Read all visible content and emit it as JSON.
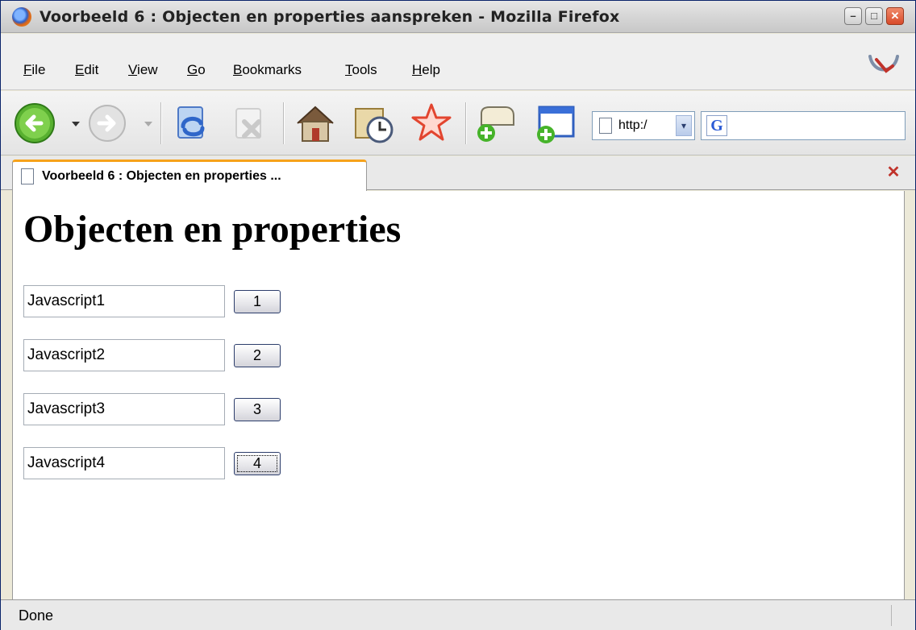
{
  "window": {
    "title": "Voorbeeld 6 : Objecten en properties aanspreken - Mozilla Firefox",
    "controls": {
      "minimize": "–",
      "maximize": "□",
      "close": "✕"
    }
  },
  "menubar": {
    "items": [
      {
        "mnemonic": "F",
        "rest": "ile"
      },
      {
        "mnemonic": "E",
        "rest": "dit"
      },
      {
        "mnemonic": "V",
        "rest": "iew"
      },
      {
        "mnemonic": "G",
        "rest": "o"
      },
      {
        "mnemonic": "B",
        "rest": "ookmarks"
      },
      {
        "mnemonic": "T",
        "rest": "ools"
      },
      {
        "mnemonic": "H",
        "rest": "elp"
      }
    ]
  },
  "toolbar": {
    "icons": [
      "back-icon",
      "forward-icon",
      "reload-icon",
      "stop-icon",
      "home-icon",
      "history-icon",
      "bookmark-star-icon",
      "new-tab-icon",
      "new-window-icon"
    ],
    "url_text": "http:/",
    "url_dropdown": "▾",
    "search_engine": "G"
  },
  "tabs": [
    {
      "label": "Voorbeeld 6 : Objecten en properties ..."
    }
  ],
  "tab_close": "✕",
  "page": {
    "heading": "Objecten en properties",
    "rows": [
      {
        "input_value": "Javascript1",
        "button_label": "1"
      },
      {
        "input_value": "Javascript2",
        "button_label": "2"
      },
      {
        "input_value": "Javascript3",
        "button_label": "3"
      },
      {
        "input_value": "Javascript4",
        "button_label": "4"
      }
    ]
  },
  "status": {
    "text": "Done"
  }
}
